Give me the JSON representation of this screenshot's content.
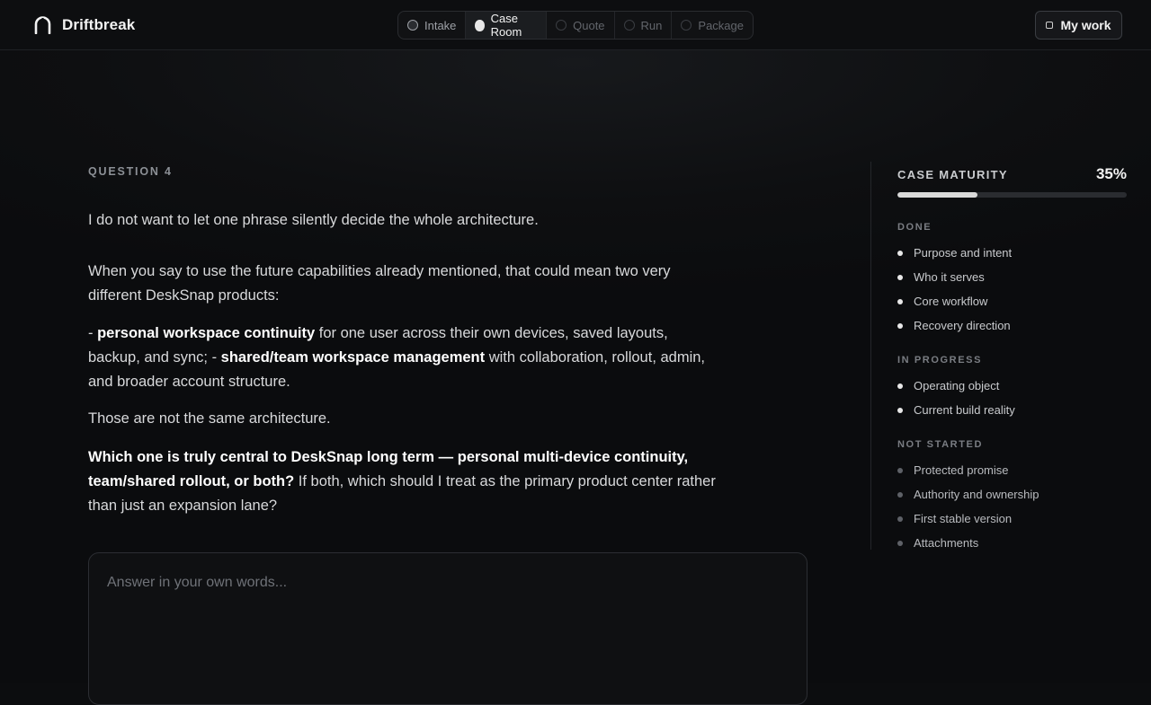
{
  "brand": {
    "name": "Driftbreak"
  },
  "steps": [
    {
      "label": "Intake",
      "state": "done"
    },
    {
      "label": "Case Room",
      "state": "active"
    },
    {
      "label": "Quote",
      "state": "todo"
    },
    {
      "label": "Run",
      "state": "todo"
    },
    {
      "label": "Package",
      "state": "todo"
    }
  ],
  "header": {
    "my_work_label": "My work"
  },
  "question": {
    "label": "QUESTION 4",
    "p1": "I do not want to let one phrase silently decide the whole architecture.",
    "p2": "When you say to use the future capabilities already mentioned, that could mean two very different DeskSnap products:",
    "p3_a": "- ",
    "p3_b": "personal workspace continuity",
    "p3_c": " for one user across their own devices, saved layouts, backup, and sync; - ",
    "p3_d": "shared/team workspace management",
    "p3_e": " with collaboration, rollout, admin, and broader account structure.",
    "p4": "Those are not the same architecture.",
    "p5_bold": "Which one is truly central to DeskSnap long term — personal multi-device continuity, team/shared rollout, or both?",
    "p5_rest": " If both, which should I treat as the primary product center rather than just an expansion lane?"
  },
  "answer": {
    "placeholder": "Answer in your own words...",
    "value": ""
  },
  "sidebar": {
    "maturity_title": "CASE MATURITY",
    "maturity_pct": "35%",
    "maturity_value": 0.35,
    "done_label": "DONE",
    "done": [
      "Purpose and intent",
      "Who it serves",
      "Core workflow",
      "Recovery direction"
    ],
    "in_progress_label": "IN PROGRESS",
    "in_progress": [
      "Operating object",
      "Current build reality"
    ],
    "not_started_label": "NOT STARTED",
    "not_started": [
      "Protected promise",
      "Authority and ownership",
      "First stable version",
      "Attachments"
    ]
  },
  "colors": {
    "accent": "#e8e8e8",
    "background": "#0c0d0f",
    "border": "#2c2e33"
  }
}
